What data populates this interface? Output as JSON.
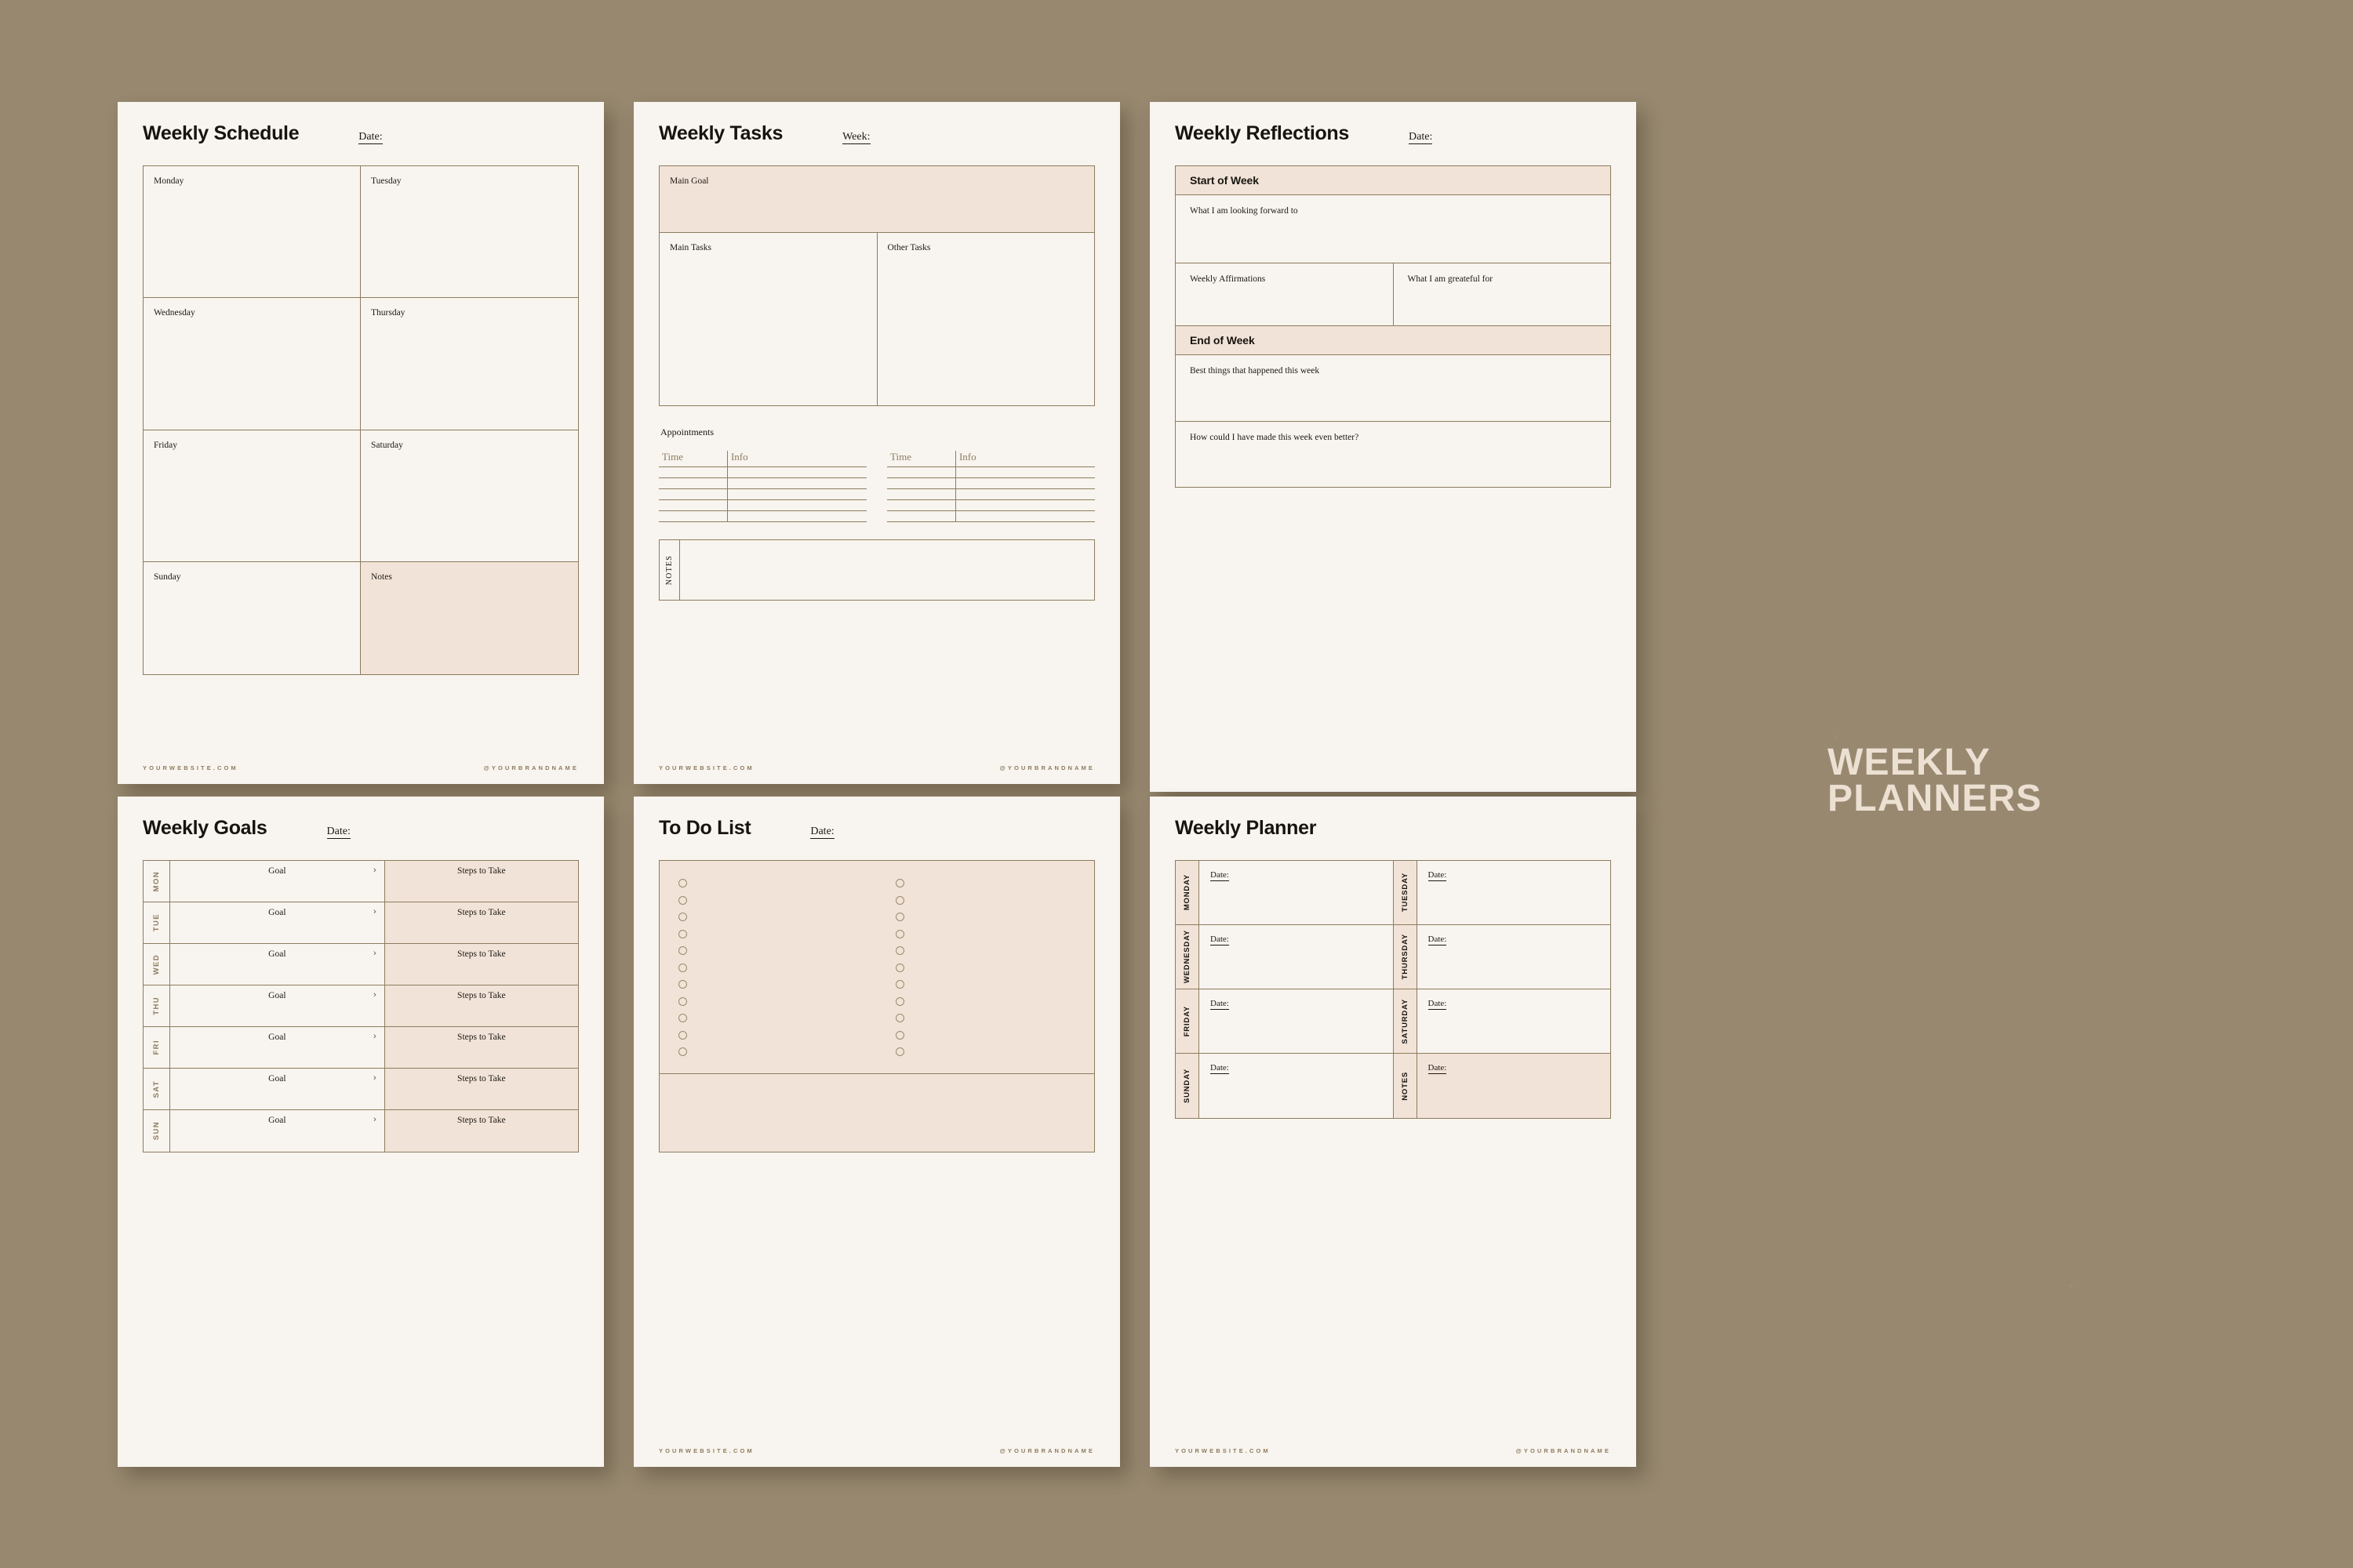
{
  "background_color": "#97886f",
  "card_color": "#f8f4ef",
  "accent_fill": "#f2e3d8",
  "line_color": "#8d7c5f",
  "brand": {
    "line1": "WEEKLY",
    "line2": "PLANNERS"
  },
  "footer": {
    "website": "YOURWEBSITE.COM",
    "handle": "@YOURBRANDNAME"
  },
  "schedule": {
    "title": "Weekly Schedule",
    "date_label": "Date:",
    "cells": [
      "Monday",
      "Tuesday",
      "Wednesday",
      "Thursday",
      "Friday",
      "Saturday",
      "Sunday",
      "Notes"
    ]
  },
  "tasks": {
    "title": "Weekly Tasks",
    "week_label": "Week:",
    "main_goal": "Main Goal",
    "main_tasks": "Main Tasks",
    "other_tasks": "Other Tasks",
    "appointments_label": "Appointments",
    "col_time": "Time",
    "col_info": "Info",
    "appointment_rows": 5,
    "notes_spine": "NOTES"
  },
  "reflections": {
    "title": "Weekly Reflections",
    "date_label": "Date:",
    "start_of_week": "Start of Week",
    "looking_forward": "What I am looking forward to",
    "affirmations": "Weekly Affirmations",
    "grateful": "What I am greateful for",
    "end_of_week": "End of Week",
    "best_things": "Best things that happened this week",
    "even_better": "How could I have made this week even better?"
  },
  "goals": {
    "title": "Weekly Goals",
    "date_label": "Date:",
    "goal_label": "Goal",
    "steps_label": "Steps to Take",
    "chevron": "›",
    "days": [
      "MON",
      "TUE",
      "WED",
      "THU",
      "FRI",
      "SAT",
      "SUN"
    ]
  },
  "todo": {
    "title": "To Do List",
    "date_label": "Date:",
    "rows_per_column": 11,
    "columns": 2
  },
  "planner": {
    "title": "Weekly Planner",
    "date_label": "Date:",
    "cells": [
      {
        "day": "MONDAY",
        "filled": false
      },
      {
        "day": "TUESDAY",
        "filled": false
      },
      {
        "day": "WEDNESDAY",
        "filled": false
      },
      {
        "day": "THURSDAY",
        "filled": false
      },
      {
        "day": "FRIDAY",
        "filled": false
      },
      {
        "day": "SATURDAY",
        "filled": false
      },
      {
        "day": "SUNDAY",
        "filled": false
      },
      {
        "day": "NOTES",
        "filled": true
      }
    ]
  }
}
